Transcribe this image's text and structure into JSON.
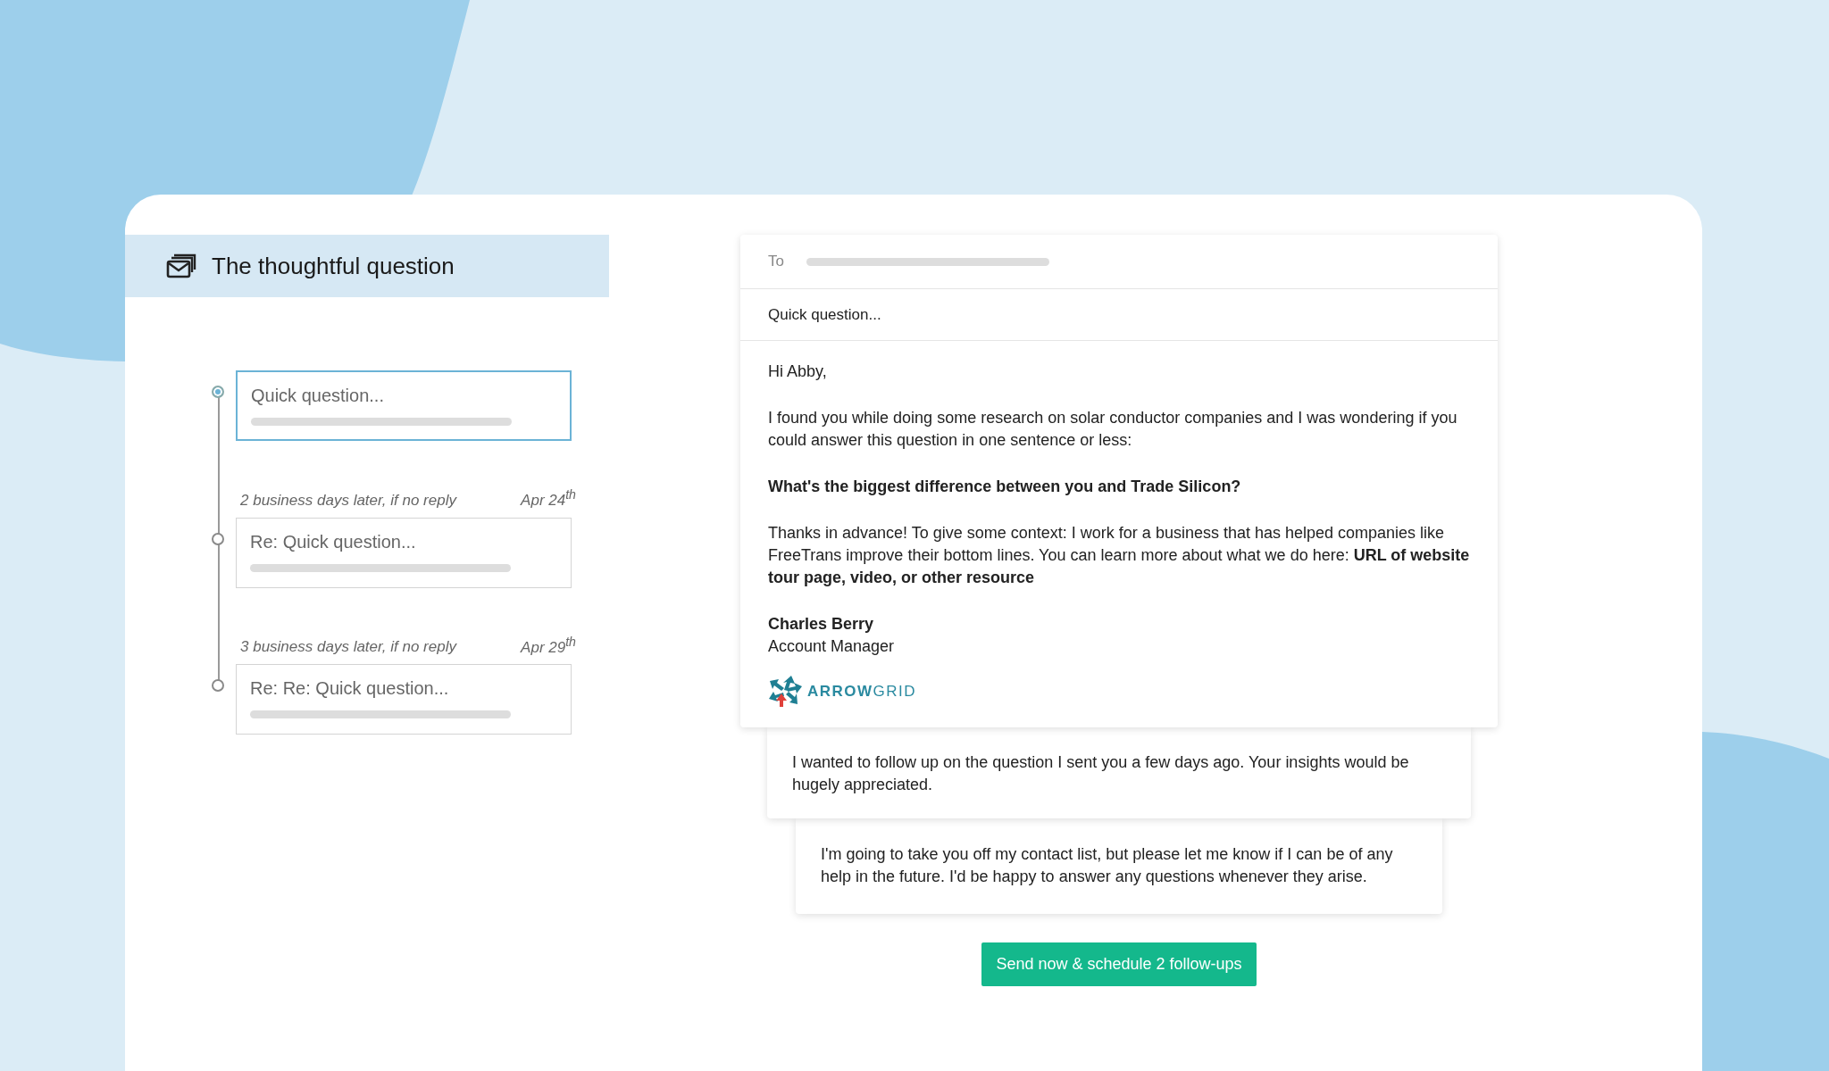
{
  "sequence": {
    "title": "The thoughtful question",
    "steps": [
      {
        "subject": "Quick question...",
        "selected": true
      },
      {
        "delay": "2 business days later, if no reply",
        "date": "Apr 24$^{th}$",
        "subject": "Re: Quick question...",
        "selected": false
      },
      {
        "delay": "3 business days later, if no reply",
        "date": "Apr 29$^{th}$",
        "subject": "Re: Re: Quick question...",
        "selected": false
      }
    ]
  },
  "email": {
    "to_label": "To",
    "subject": "Quick question...",
    "body": [
      "Hi Abby,",
      "I found you while doing some research on solar conductor companies and I was wondering if you could answer this question in one sentence or less:",
      "**What's the biggest difference between you and Trade Silicon?**",
      "Thanks in advance! To give some context: I work for a business that has helped companies like FreeTrans improve their bottom lines. You can learn more about what we do here: **URL of website tour page, video, or other resource**"
    ],
    "signature_name": "Charles Berry",
    "signature_title": "Account Manager",
    "logo": "**ARROW**GRID"
  },
  "follow_ups": [
    "I wanted to follow up on the question I sent you a few days ago. Your insights would be hugely appreciated.",
    "I'm going to take you off my contact list, but please let me know if I can be of any help in the future. I'd be happy to answer any questions whenever they arise."
  ],
  "send_button": "Send now & schedule 2 follow-ups"
}
